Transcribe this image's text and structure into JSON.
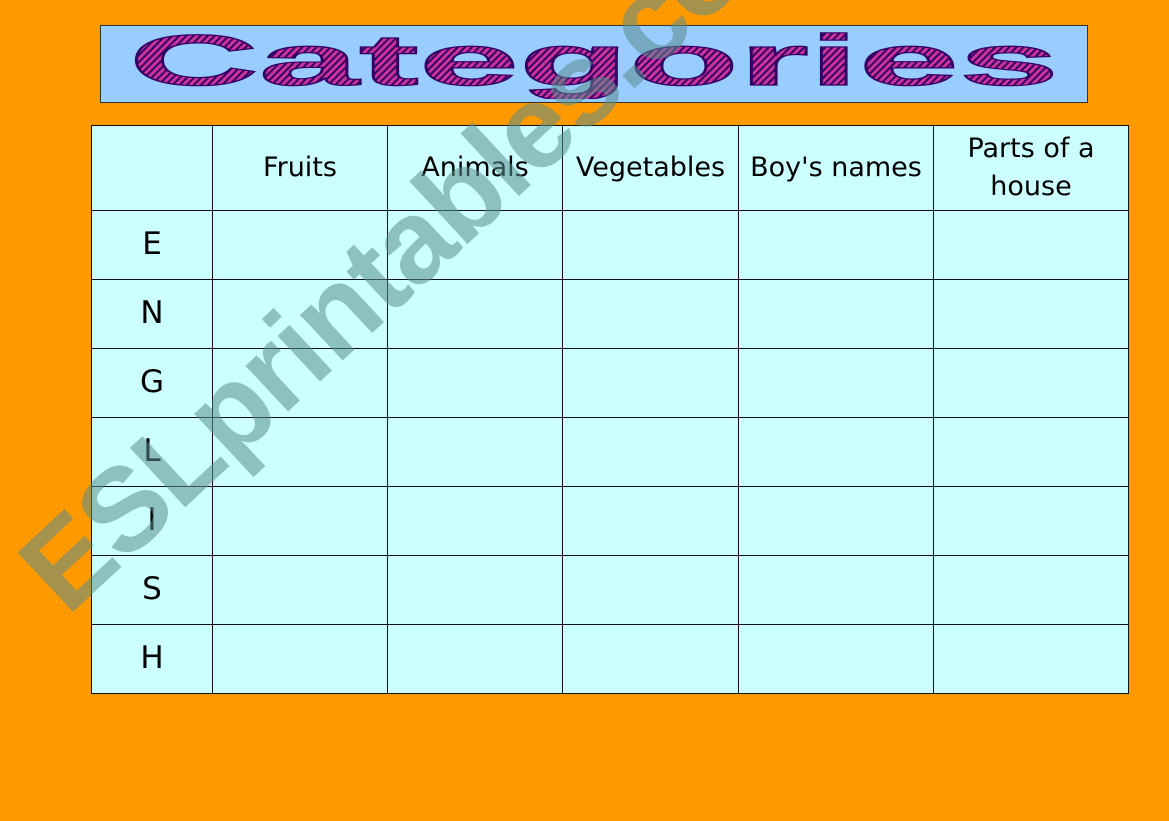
{
  "title": "Categories",
  "colors": {
    "background": "#FF9900",
    "title_box": "#99CCFF",
    "title_text": "#993399",
    "table_fill": "#CCFFFF"
  },
  "table": {
    "headers": [
      "",
      "Fruits",
      "Animals",
      "Vegetables",
      "Boy's names",
      "Parts of a house"
    ],
    "rows": [
      {
        "letter": "E",
        "cells": [
          "",
          "",
          "",
          "",
          ""
        ]
      },
      {
        "letter": "N",
        "cells": [
          "",
          "",
          "",
          "",
          ""
        ]
      },
      {
        "letter": "G",
        "cells": [
          "",
          "",
          "",
          "",
          ""
        ]
      },
      {
        "letter": "L",
        "cells": [
          "",
          "",
          "",
          "",
          ""
        ]
      },
      {
        "letter": "I",
        "cells": [
          "",
          "",
          "",
          "",
          ""
        ]
      },
      {
        "letter": "S",
        "cells": [
          "",
          "",
          "",
          "",
          ""
        ]
      },
      {
        "letter": "H",
        "cells": [
          "",
          "",
          "",
          "",
          ""
        ]
      }
    ]
  },
  "watermark": "ESLprintables.com"
}
